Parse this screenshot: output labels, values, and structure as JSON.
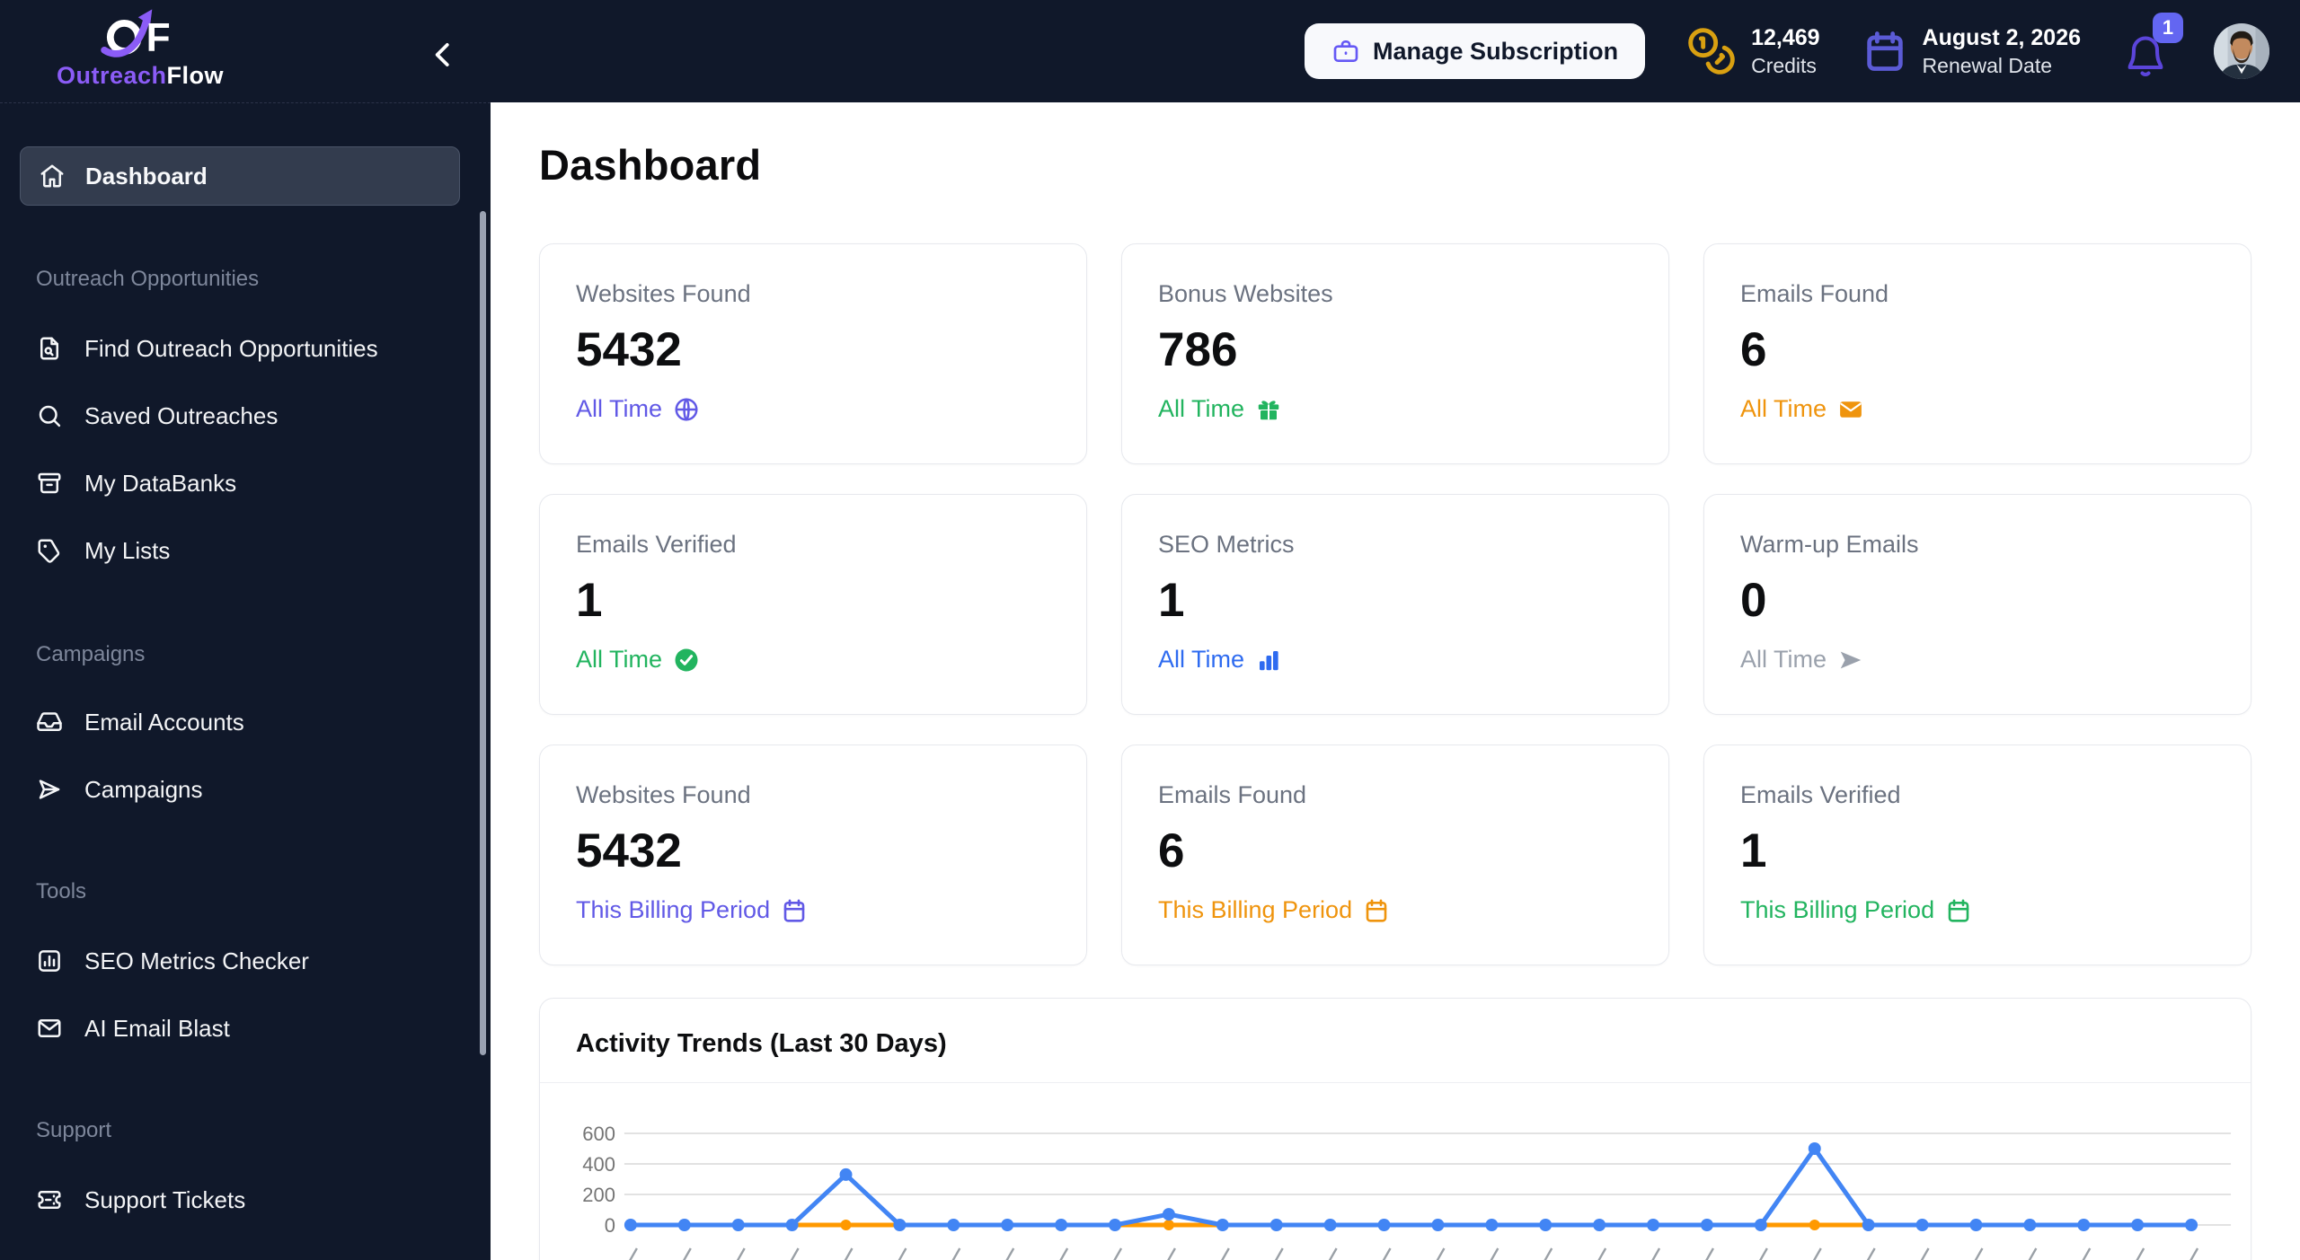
{
  "brand": {
    "name_primary": "Outreach",
    "name_secondary": "Flow"
  },
  "topbar": {
    "manage_subscription_label": "Manage Subscription",
    "credits_value": "12,469",
    "credits_label": "Credits",
    "renewal_value": "August 2, 2026",
    "renewal_label": "Renewal Date",
    "notification_count": "1"
  },
  "sidebar": {
    "active_item": "Dashboard",
    "sections": [
      {
        "title": "Outreach Opportunities",
        "items": [
          {
            "label": "Find Outreach Opportunities"
          },
          {
            "label": "Saved Outreaches"
          },
          {
            "label": "My DataBanks"
          },
          {
            "label": "My Lists"
          }
        ]
      },
      {
        "title": "Campaigns",
        "items": [
          {
            "label": "Email Accounts"
          },
          {
            "label": "Campaigns"
          }
        ]
      },
      {
        "title": "Tools",
        "items": [
          {
            "label": "SEO Metrics Checker"
          },
          {
            "label": "AI Email Blast"
          }
        ]
      },
      {
        "title": "Support",
        "items": [
          {
            "label": "Support Tickets"
          }
        ]
      }
    ]
  },
  "main": {
    "page_title": "Dashboard",
    "cards": [
      {
        "title": "Websites Found",
        "value": "5432",
        "period": "All Time",
        "icon": "globe",
        "color": "#6366f1"
      },
      {
        "title": "Bonus Websites",
        "value": "786",
        "period": "All Time",
        "icon": "gift",
        "color": "#22b45f"
      },
      {
        "title": "Emails Found",
        "value": "6",
        "period": "All Time",
        "icon": "mail",
        "color": "#ef940d"
      },
      {
        "title": "Emails Verified",
        "value": "1",
        "period": "All Time",
        "icon": "check-circle",
        "color": "#22b45f"
      },
      {
        "title": "SEO Metrics",
        "value": "1",
        "period": "All Time",
        "icon": "bar-chart",
        "color": "#2e6bf0"
      },
      {
        "title": "Warm-up Emails",
        "value": "0",
        "period": "All Time",
        "icon": "send",
        "color": "#9aa1ac"
      },
      {
        "title": "Websites Found",
        "value": "5432",
        "period": "This Billing Period",
        "icon": "calendar",
        "color": "#6366f1"
      },
      {
        "title": "Emails Found",
        "value": "6",
        "period": "This Billing Period",
        "icon": "calendar",
        "color": "#ef940d"
      },
      {
        "title": "Emails Verified",
        "value": "1",
        "period": "This Billing Period",
        "icon": "calendar",
        "color": "#22b45f"
      }
    ]
  },
  "chart_data": {
    "type": "line",
    "title": "Activity Trends (Last 30 Days)",
    "x": [
      1,
      2,
      3,
      4,
      5,
      6,
      7,
      8,
      9,
      10,
      11,
      12,
      13,
      14,
      15,
      16,
      17,
      18,
      19,
      20,
      21,
      22,
      23,
      24,
      25,
      26,
      27,
      28,
      29,
      30
    ],
    "series": [
      {
        "name": "series-blue",
        "color": "#4285f4",
        "values": [
          0,
          0,
          0,
          0,
          330,
          0,
          0,
          0,
          0,
          0,
          70,
          0,
          0,
          0,
          0,
          0,
          0,
          0,
          0,
          0,
          0,
          0,
          500,
          0,
          0,
          0,
          0,
          0,
          0,
          0
        ]
      },
      {
        "name": "series-orange",
        "color": "#ff9900",
        "values": [
          0,
          0,
          0,
          0,
          0,
          0,
          0,
          0,
          0,
          0,
          0,
          0,
          0,
          0,
          0,
          0,
          0,
          0,
          0,
          0,
          0,
          0,
          0,
          0,
          0,
          0,
          0,
          0,
          0,
          0
        ]
      }
    ],
    "ylim": [
      0,
      600
    ],
    "yticks": [
      0,
      200,
      400,
      600
    ],
    "grid": true,
    "x_axis_note": "rotated date labels clipped at bottom edge of viewport"
  },
  "colors": {
    "topbar_bg": "#10182a",
    "accent_purple": "#6366f1",
    "green": "#22b45f",
    "orange": "#ef940d",
    "blue": "#2e6bf0",
    "gray": "#9aa1ac",
    "chart_blue": "#4285f4",
    "chart_orange": "#ff9900",
    "gold": "#d9a011"
  }
}
